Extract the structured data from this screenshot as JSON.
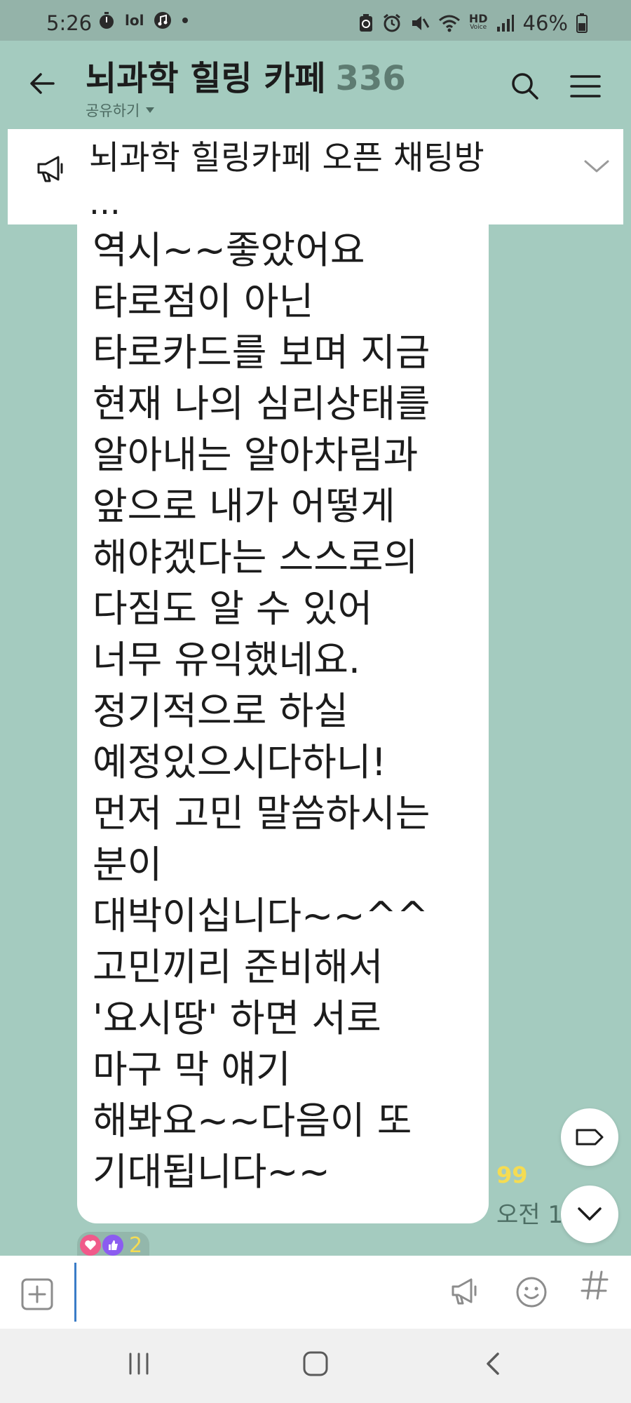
{
  "status_bar": {
    "time": "5:26",
    "battery": "46%",
    "network_label": "HD",
    "voice_label": "Voice",
    "signal_bars_label": "lol"
  },
  "header": {
    "title": "뇌과학 힐링 카페",
    "member_count": "336",
    "share_label": "공유하기"
  },
  "notice": {
    "text": "뇌과학 힐링카페 오픈 채팅방\n..."
  },
  "message": {
    "text": "역시~~좋았어요\n타로점이 아닌\n타로카드를 보며 지금\n현재 나의 심리상태를\n알아내는 알아차림과\n앞으로 내가 어떻게\n해야겠다는 스스로의\n다짐도 알 수 있어\n너무 유익했네요.\n정기적으로 하실\n예정있으시다하니!\n먼저 고민 말씀하시는\n분이\n대박이십니다~~^^\n고민끼리 준비해서\n'요시땅' 하면 서로\n마구 막 얘기\n해봐요~~다음이 또\n기대됩니다~~",
    "unread_count": "99",
    "time": "오전 1",
    "reaction_count": "2"
  },
  "input": {
    "placeholder": ""
  },
  "colors": {
    "chat_background": "#a4cbbf",
    "status_bar_background": "#94b3a9",
    "member_count": "#5e7c72",
    "unread_yellow": "#f5dc52",
    "cursor_blue": "#3a7cc7",
    "reaction_heart": "#f05a8a",
    "reaction_thumb": "#8b5cf0"
  },
  "icons": {
    "back": "arrow-left-icon",
    "search": "search-icon",
    "menu": "hamburger-menu-icon",
    "notice": "megaphone-icon",
    "notice_expand": "chevron-down-icon",
    "tag": "tag-icon",
    "scroll_down": "chevron-down-icon",
    "add": "plus-square-icon",
    "broadcast": "megaphone-icon",
    "emoji": "smiley-icon",
    "hash": "hashtag-icon",
    "nav_recent": "recent-apps-icon",
    "nav_home": "home-icon",
    "nav_back": "chevron-left-icon"
  }
}
